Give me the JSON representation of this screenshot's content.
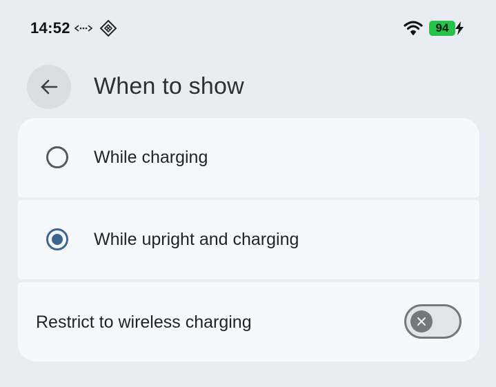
{
  "status_bar": {
    "time": "14:52",
    "battery_level": "94",
    "icons": [
      "link-icon",
      "diamond-grid-icon",
      "wifi-icon",
      "charging-bolt-icon"
    ]
  },
  "header": {
    "title": "When to show",
    "back_icon": "arrow-left-icon"
  },
  "options": [
    {
      "label": "While charging",
      "selected": false
    },
    {
      "label": "While upright and charging",
      "selected": true
    }
  ],
  "restrict": {
    "label": "Restrict to wireless charging",
    "enabled": false
  },
  "colors": {
    "background": "#e9ecf2",
    "card": "#f7f8fb",
    "accent": "#3c6591",
    "battery": "#27c24c"
  }
}
